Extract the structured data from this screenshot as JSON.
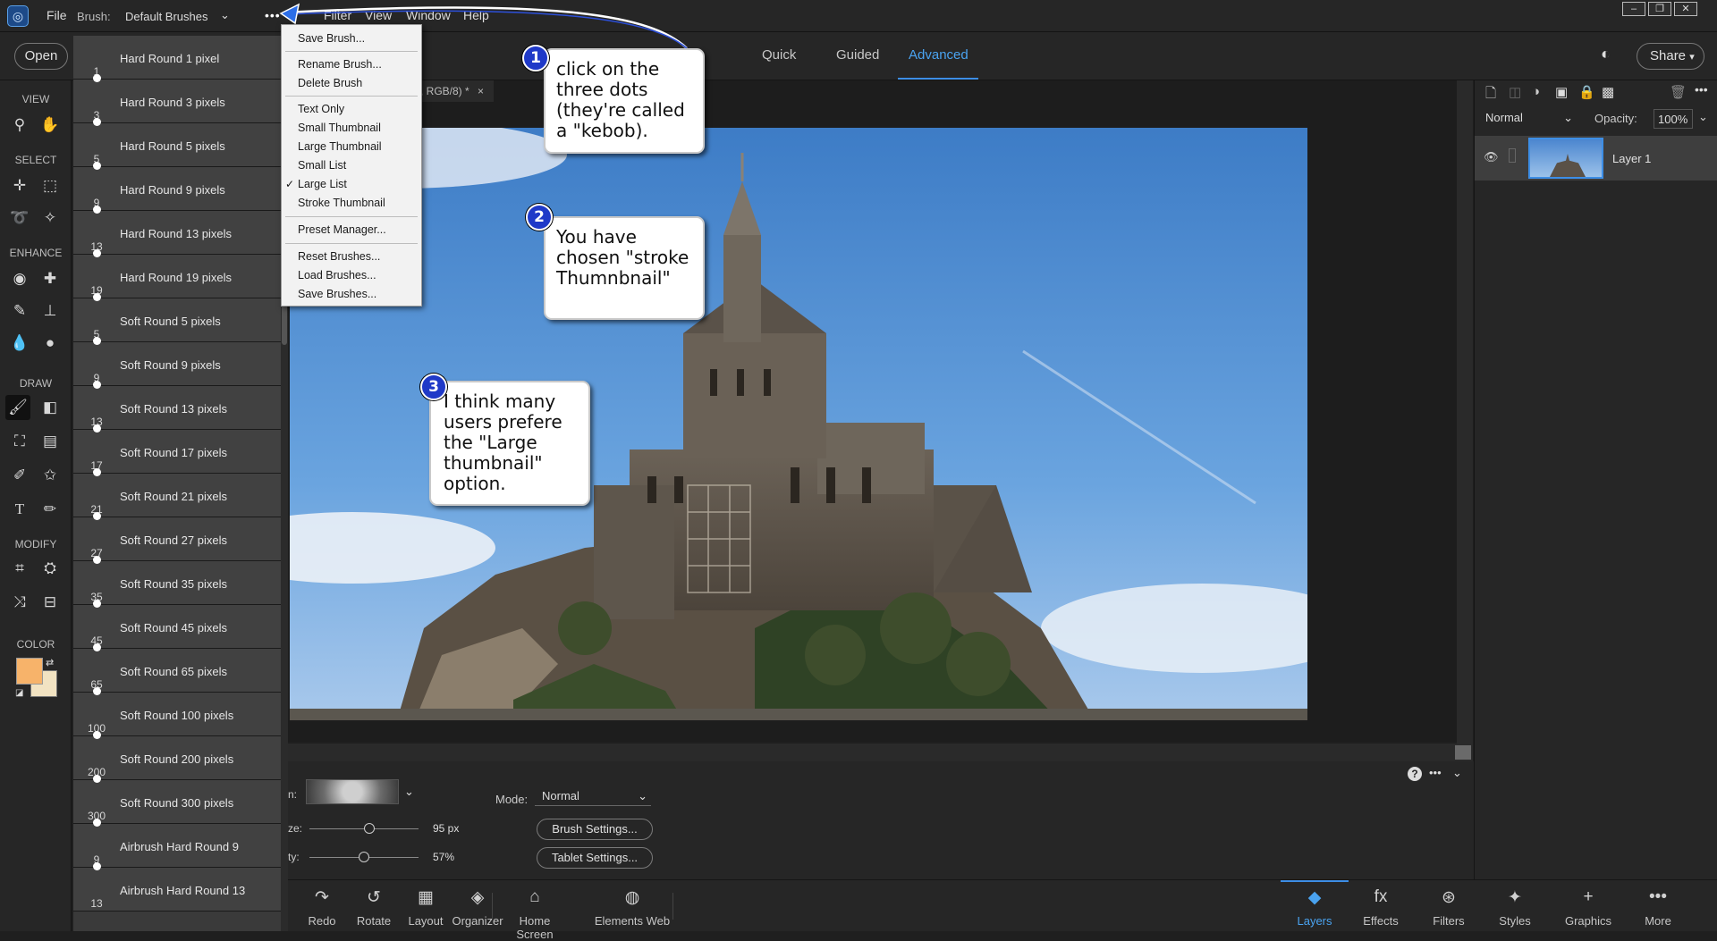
{
  "menubar": {
    "items": [
      "File",
      "Brush:",
      "Default Brushes",
      "Filter",
      "View",
      "Window",
      "Help"
    ],
    "kebab": "•••"
  },
  "toprow": {
    "open_label": "Open",
    "modes": [
      "Quick",
      "Guided",
      "Advanced"
    ],
    "active_mode": "Advanced",
    "share_label": "Share"
  },
  "toolbar": {
    "sections": [
      "VIEW",
      "SELECT",
      "ENHANCE",
      "DRAW",
      "MODIFY",
      "COLOR"
    ],
    "foreground_color": "#f7b36a",
    "background_color": "#f2e3c2"
  },
  "brushes": [
    {
      "num": "1",
      "name": "Hard Round 1 pixel"
    },
    {
      "num": "3",
      "name": "Hard Round 3 pixels"
    },
    {
      "num": "5",
      "name": "Hard Round 5 pixels"
    },
    {
      "num": "9",
      "name": "Hard Round 9 pixels"
    },
    {
      "num": "13",
      "name": "Hard Round 13 pixels"
    },
    {
      "num": "19",
      "name": "Hard Round 19 pixels"
    },
    {
      "num": "5",
      "name": "Soft Round 5 pixels"
    },
    {
      "num": "9",
      "name": "Soft Round 9 pixels"
    },
    {
      "num": "13",
      "name": "Soft Round 13 pixels"
    },
    {
      "num": "17",
      "name": "Soft Round 17 pixels"
    },
    {
      "num": "21",
      "name": "Soft Round 21 pixels"
    },
    {
      "num": "27",
      "name": "Soft Round 27 pixels"
    },
    {
      "num": "35",
      "name": "Soft Round 35 pixels"
    },
    {
      "num": "45",
      "name": "Soft Round 45 pixels"
    },
    {
      "num": "65",
      "name": "Soft Round 65 pixels"
    },
    {
      "num": "100",
      "name": "Soft Round 100 pixels"
    },
    {
      "num": "200",
      "name": "Soft Round 200 pixels"
    },
    {
      "num": "300",
      "name": "Soft Round 300 pixels"
    },
    {
      "num": "9",
      "name": "Airbrush Hard Round 9"
    },
    {
      "num": "13",
      "name": "Airbrush Hard Round 13"
    }
  ],
  "dropdown": {
    "items": [
      "Save Brush...",
      "Rename Brush...",
      "Delete Brush",
      "Text Only",
      "Small Thumbnail",
      "Large Thumbnail",
      "Small List",
      "Large List",
      "Stroke Thumbnail",
      "Preset Manager...",
      "Reset Brushes...",
      "Load Brushes...",
      "Save Brushes..."
    ],
    "checked": "Large List",
    "check_mark": "✓"
  },
  "document": {
    "tab_title": ", RGB/8) *",
    "close": "×"
  },
  "layers": {
    "blend_mode": "Normal",
    "opacity_label": "Opacity:",
    "opacity_value": "100%",
    "layer_name": "Layer 1"
  },
  "options": {
    "row1_label": "n:",
    "mode_label": "Mode:",
    "mode_value": "Normal",
    "size_label": "ze:",
    "size_value": "95 px",
    "size_level": 0.55,
    "opacity_label": "ty:",
    "opacity_value": "57%",
    "opacity_level": 0.5,
    "brush_settings": "Brush Settings...",
    "tablet_settings": "Tablet Settings..."
  },
  "bottombar": {
    "left": [
      {
        "label": "Redo",
        "icon": "↷"
      },
      {
        "label": "Rotate",
        "icon": "↺"
      },
      {
        "label": "Layout",
        "icon": "▦"
      },
      {
        "label": "Organizer",
        "icon": "◈"
      },
      {
        "label": "Home Screen",
        "icon": "⌂"
      },
      {
        "label": "Elements Web",
        "icon": "◍"
      }
    ],
    "right": [
      {
        "label": "Layers",
        "icon": "◆"
      },
      {
        "label": "Effects",
        "icon": "fx"
      },
      {
        "label": "Filters",
        "icon": "⊛"
      },
      {
        "label": "Styles",
        "icon": "✦"
      },
      {
        "label": "Graphics",
        "icon": "+"
      },
      {
        "label": "More",
        "icon": "•••"
      }
    ],
    "active": "Layers"
  },
  "callouts": [
    {
      "num": "1",
      "text": "click on the three dots (they're called a \"kebob)."
    },
    {
      "num": "2",
      "text": "You have chosen \"stroke Thumnbnail\""
    },
    {
      "num": "3",
      "text": "I think many users prefere the \"Large thumbnail\" option."
    }
  ]
}
